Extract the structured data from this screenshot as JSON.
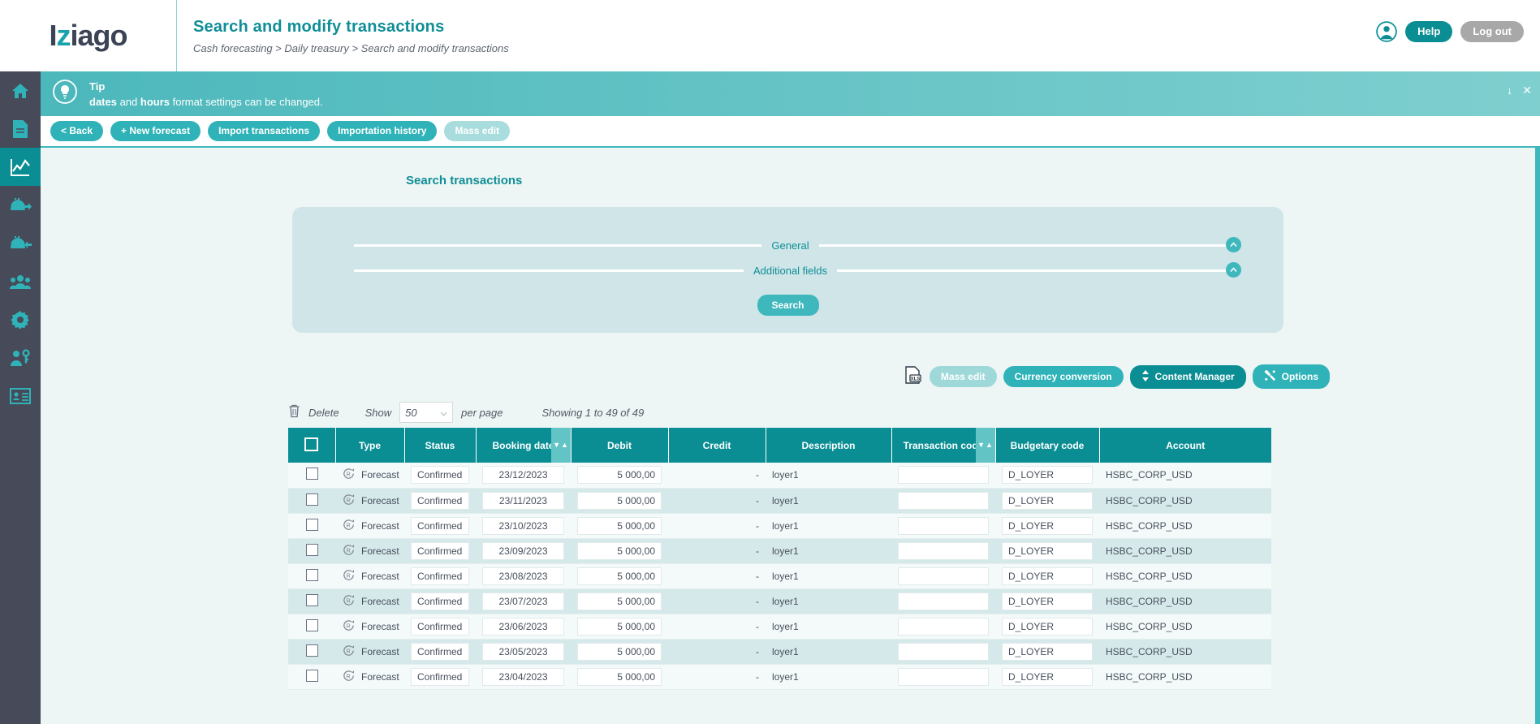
{
  "brand": {
    "logo_text": "Iziago",
    "logo_accent_letter": "z",
    "accent_color": "#0a8e94"
  },
  "header": {
    "title": "Search and modify transactions",
    "breadcrumb": "Cash forecasting > Daily treasury > Search and modify transactions",
    "avatar_icon": "user-circle-icon",
    "help_label": "Help",
    "logout_label": "Log out"
  },
  "sidebar": {
    "items": [
      {
        "icon": "home-icon",
        "active": false
      },
      {
        "icon": "document-icon",
        "active": false
      },
      {
        "icon": "chart-line-icon",
        "active": true
      },
      {
        "icon": "wallet-out-icon",
        "active": false
      },
      {
        "icon": "wallet-in-icon",
        "active": false
      },
      {
        "icon": "users-icon",
        "active": false
      },
      {
        "icon": "gear-icon",
        "active": false
      },
      {
        "icon": "user-key-icon",
        "active": false
      },
      {
        "icon": "id-card-icon",
        "active": false
      }
    ]
  },
  "tip": {
    "icon": "lightbulb-icon",
    "title": "Tip",
    "text_bold_1": "dates",
    "text_mid": " and ",
    "text_bold_2": "hours",
    "text_rest": " format settings can be changed.",
    "collapse_icon": "arrow-down-icon",
    "close_icon": "close-icon"
  },
  "toolbar": {
    "buttons": [
      {
        "label": "< Back",
        "disabled": false
      },
      {
        "label": "+ New forecast",
        "disabled": false
      },
      {
        "label": "Import transactions",
        "disabled": false
      },
      {
        "label": "Importation history",
        "disabled": false
      },
      {
        "label": "Mass edit",
        "disabled": true
      }
    ]
  },
  "search": {
    "heading": "Search transactions",
    "sections": [
      {
        "label": "General",
        "toggle_icon": "chevron-up-icon"
      },
      {
        "label": "Additional fields",
        "toggle_icon": "chevron-up-icon"
      }
    ],
    "submit_label": "Search"
  },
  "actions": {
    "export_icon": "xls-export-icon",
    "buttons": [
      {
        "label": "Mass edit",
        "style": "disabled",
        "icon": null
      },
      {
        "label": "Currency conversion",
        "style": "primary",
        "icon": null
      },
      {
        "label": "Content Manager",
        "style": "dark",
        "icon": "updown-arrows-icon"
      },
      {
        "label": "Options",
        "style": "primary",
        "icon": "tools-icon"
      }
    ]
  },
  "table_controls": {
    "delete_icon": "trash-icon",
    "delete_label": "Delete",
    "show_label": "Show",
    "per_page_value": "50",
    "per_page_label": "per page",
    "showing_text": "Showing 1 to 49 of 49"
  },
  "table": {
    "select_all_icon": "checkbox-icon",
    "columns": [
      {
        "label": "",
        "key": "select",
        "sortable": false
      },
      {
        "label": "Type",
        "key": "type",
        "sortable": false
      },
      {
        "label": "Status",
        "key": "status",
        "sortable": false
      },
      {
        "label": "Booking date",
        "key": "booking_date",
        "sortable": true
      },
      {
        "label": "Debit",
        "key": "debit",
        "sortable": false
      },
      {
        "label": "Credit",
        "key": "credit",
        "sortable": false
      },
      {
        "label": "Description",
        "key": "description",
        "sortable": false
      },
      {
        "label": "Transaction code",
        "key": "transaction_code",
        "sortable": true
      },
      {
        "label": "Budgetary code",
        "key": "budgetary_code",
        "sortable": false
      },
      {
        "label": "Account",
        "key": "account",
        "sortable": false
      }
    ],
    "row_icon": "recurring-forecast-icon",
    "rows": [
      {
        "type": "Forecast",
        "status": "Confirmed",
        "booking_date": "23/12/2023",
        "debit": "5 000,00",
        "credit": "-",
        "description": "loyer1",
        "transaction_code": "",
        "budgetary_code": "D_LOYER",
        "account": "HSBC_CORP_USD"
      },
      {
        "type": "Forecast",
        "status": "Confirmed",
        "booking_date": "23/11/2023",
        "debit": "5 000,00",
        "credit": "-",
        "description": "loyer1",
        "transaction_code": "",
        "budgetary_code": "D_LOYER",
        "account": "HSBC_CORP_USD"
      },
      {
        "type": "Forecast",
        "status": "Confirmed",
        "booking_date": "23/10/2023",
        "debit": "5 000,00",
        "credit": "-",
        "description": "loyer1",
        "transaction_code": "",
        "budgetary_code": "D_LOYER",
        "account": "HSBC_CORP_USD"
      },
      {
        "type": "Forecast",
        "status": "Confirmed",
        "booking_date": "23/09/2023",
        "debit": "5 000,00",
        "credit": "-",
        "description": "loyer1",
        "transaction_code": "",
        "budgetary_code": "D_LOYER",
        "account": "HSBC_CORP_USD"
      },
      {
        "type": "Forecast",
        "status": "Confirmed",
        "booking_date": "23/08/2023",
        "debit": "5 000,00",
        "credit": "-",
        "description": "loyer1",
        "transaction_code": "",
        "budgetary_code": "D_LOYER",
        "account": "HSBC_CORP_USD"
      },
      {
        "type": "Forecast",
        "status": "Confirmed",
        "booking_date": "23/07/2023",
        "debit": "5 000,00",
        "credit": "-",
        "description": "loyer1",
        "transaction_code": "",
        "budgetary_code": "D_LOYER",
        "account": "HSBC_CORP_USD"
      },
      {
        "type": "Forecast",
        "status": "Confirmed",
        "booking_date": "23/06/2023",
        "debit": "5 000,00",
        "credit": "-",
        "description": "loyer1",
        "transaction_code": "",
        "budgetary_code": "D_LOYER",
        "account": "HSBC_CORP_USD"
      },
      {
        "type": "Forecast",
        "status": "Confirmed",
        "booking_date": "23/05/2023",
        "debit": "5 000,00",
        "credit": "-",
        "description": "loyer1",
        "transaction_code": "",
        "budgetary_code": "D_LOYER",
        "account": "HSBC_CORP_USD"
      },
      {
        "type": "Forecast",
        "status": "Confirmed",
        "booking_date": "23/04/2023",
        "debit": "5 000,00",
        "credit": "-",
        "description": "loyer1",
        "transaction_code": "",
        "budgetary_code": "D_LOYER",
        "account": "HSBC_CORP_USD"
      }
    ]
  }
}
